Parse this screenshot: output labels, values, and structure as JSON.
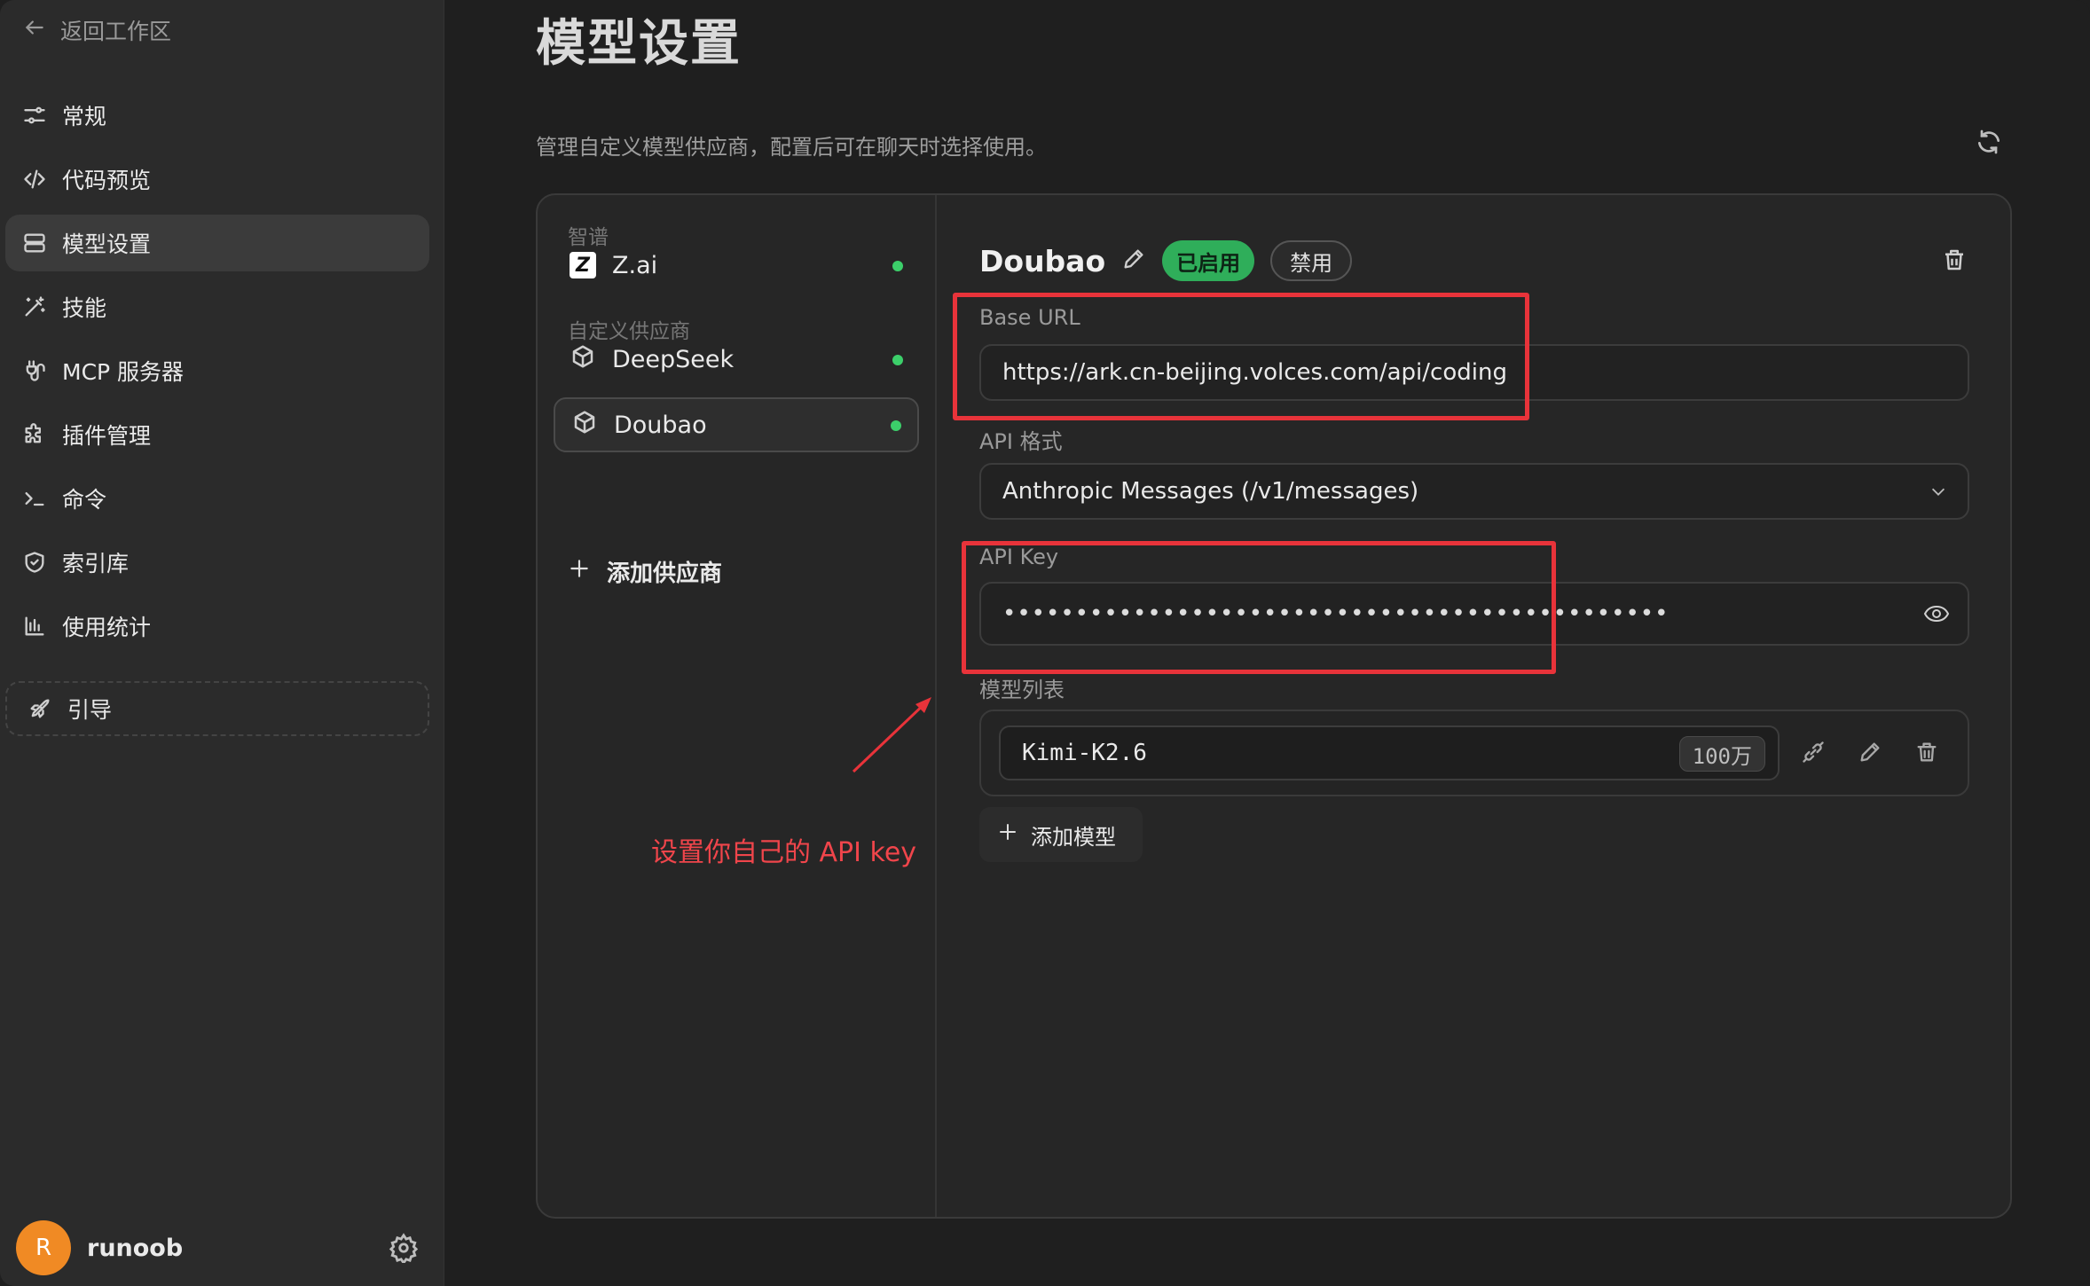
{
  "sidebar": {
    "back_label": "返回工作区",
    "items": [
      {
        "label": "常规",
        "icon": "sliders-icon"
      },
      {
        "label": "代码预览",
        "icon": "code-icon"
      },
      {
        "label": "模型设置",
        "icon": "server-icon",
        "active": true
      },
      {
        "label": "技能",
        "icon": "magic-wand-icon"
      },
      {
        "label": "MCP 服务器",
        "icon": "plug-icon"
      },
      {
        "label": "插件管理",
        "icon": "puzzle-icon"
      },
      {
        "label": "命令",
        "icon": "terminal-icon"
      },
      {
        "label": "索引库",
        "icon": "shield-icon"
      },
      {
        "label": "使用统计",
        "icon": "bar-chart-icon"
      }
    ],
    "guide_label": "引导",
    "user": {
      "initial": "R",
      "name": "runoob",
      "avatar_color": "#f08a24"
    }
  },
  "header": {
    "title": "模型设置",
    "subtitle": "管理自定义模型供应商，配置后可在聊天时选择使用。"
  },
  "providers": {
    "group_builtin": "智谱",
    "builtin": [
      {
        "name": "Z.ai",
        "status": "online"
      }
    ],
    "group_custom": "自定义供应商",
    "custom": [
      {
        "name": "DeepSeek",
        "status": "online"
      },
      {
        "name": "Doubao",
        "status": "online",
        "selected": true
      }
    ],
    "add_label": "添加供应商"
  },
  "detail": {
    "name": "Doubao",
    "enabled_label": "已启用",
    "disable_label": "禁用",
    "base_url_label": "Base URL",
    "base_url": "https://ark.cn-beijing.volces.com/api/coding",
    "api_format_label": "API 格式",
    "api_format": "Anthropic Messages (/v1/messages)",
    "api_key_label": "API Key",
    "api_key_masked": "••••••••••••••••••••••••••••••••••••••••••••••",
    "model_list_label": "模型列表",
    "models": [
      {
        "name": "Kimi-K2.6",
        "context": "100万"
      }
    ],
    "add_model_label": "添加模型"
  },
  "annotation": {
    "text": "设置你自己的 API key",
    "color": "#e8333a"
  },
  "colors": {
    "accent_green": "#2fae5a",
    "status_dot": "#3ccf6a"
  }
}
